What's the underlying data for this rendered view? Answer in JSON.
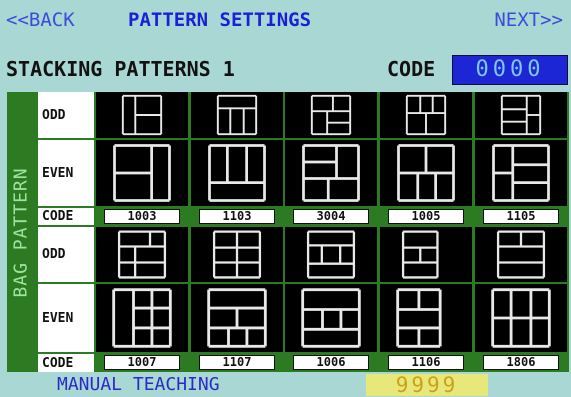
{
  "header": {
    "back": "<<BACK",
    "title": "PATTERN SETTINGS",
    "next": "NEXT>>"
  },
  "stacking": {
    "label": "STACKING PATTERNS 1",
    "code_label": "CODE",
    "code_value": "0000"
  },
  "grid": {
    "side_label": "BAG PATTERN",
    "rows": {
      "odd": "ODD",
      "even": "EVEN",
      "code": "CODE"
    },
    "top_codes": [
      "1003",
      "1103",
      "3004",
      "1005",
      "1105"
    ],
    "bottom_codes": [
      "1007",
      "1107",
      "1006",
      "1106",
      "1806"
    ]
  },
  "footer": {
    "manual": "MANUAL TEACHING",
    "counter": "9999"
  },
  "colors": {
    "background": "#a9d8d4",
    "grid": "#2c7a21",
    "header_text": "#1a1fd8",
    "code_field": "#1c26d4",
    "counter_bg": "#e8e87a"
  }
}
